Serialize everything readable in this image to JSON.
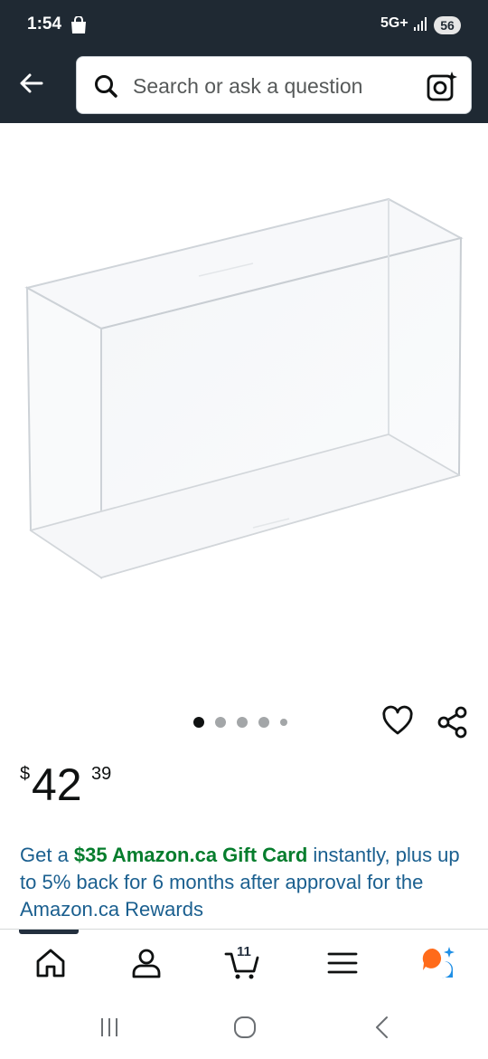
{
  "status_bar": {
    "time": "1:54",
    "network": "5G+",
    "battery": "56"
  },
  "search": {
    "placeholder": "Search or ask a question"
  },
  "carousel": {
    "total": 5,
    "active_index": 0
  },
  "price": {
    "symbol": "$",
    "whole": "42",
    "fraction": "39"
  },
  "promo": {
    "part1": "Get a ",
    "highlight": "$35 Amazon.ca Gift Card",
    "part2": " instantly, plus up to 5% back for 6 months after approval for the Amazon.ca Rewards"
  },
  "bottom_nav": {
    "cart_count": "11"
  },
  "colors": {
    "header_bg": "#1f2933",
    "link_blue": "#1a5f8f",
    "deal_green": "#067d2d",
    "ai_orange": "#ff6b1a",
    "ai_blue": "#1f8fe6"
  },
  "icons": [
    "bag-icon",
    "signal-icon",
    "back-arrow-icon",
    "search-icon",
    "camera-icon",
    "heart-icon",
    "share-icon",
    "home-icon",
    "account-icon",
    "cart-icon",
    "menu-icon",
    "ai-assistant-icon"
  ]
}
